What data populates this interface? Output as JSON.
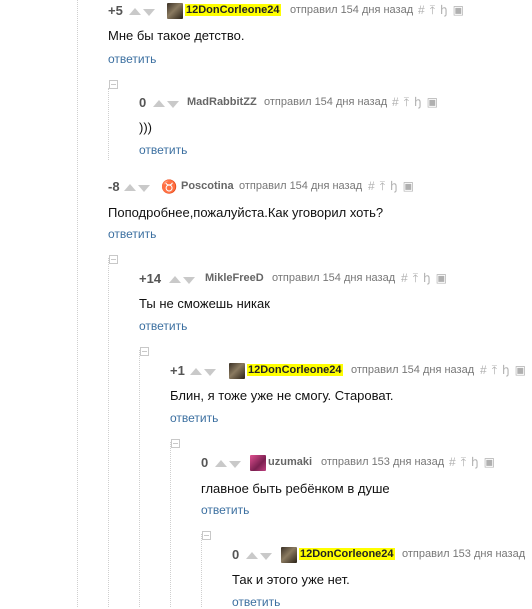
{
  "comments": [
    {
      "rating": "+5",
      "user": "12DonCorleone24",
      "posted": "отправил 154 дня назад",
      "text": "Мне бы такое детство.",
      "reply": "ответить"
    },
    {
      "rating": "0",
      "user": "MadRabbitZZ",
      "posted": "отправил 154 дня назад",
      "text": ")))",
      "reply": "ответить"
    },
    {
      "rating": "-8",
      "user": "Poscotina",
      "posted": "отправил 154 дня назад",
      "text": "Поподробнее,пожалуйста.Как уговорил хоть?",
      "reply": "ответить"
    },
    {
      "rating": "+14",
      "user": "MikleFreeD",
      "posted": "отправил 154 дня назад",
      "text": "Ты не сможешь никак",
      "reply": "ответить"
    },
    {
      "rating": "+1",
      "user": "12DonCorleone24",
      "posted": "отправил 154 дня назад",
      "text": "Блин, я тоже уже не смогу. Староват.",
      "reply": "ответить"
    },
    {
      "rating": "0",
      "user": "uzumaki",
      "posted": "отправил 153 дня назад",
      "text": "главное быть ребёнком в душе",
      "reply": "ответить"
    },
    {
      "rating": "0",
      "user": "12DonCorleone24",
      "posted": "отправил 153 дня назад",
      "text": "Так и этого уже нет.",
      "reply": "ответить"
    }
  ],
  "icons": {
    "hash": "#",
    "pin": "⤒",
    "tree": "ꜧ",
    "save": "▣"
  }
}
